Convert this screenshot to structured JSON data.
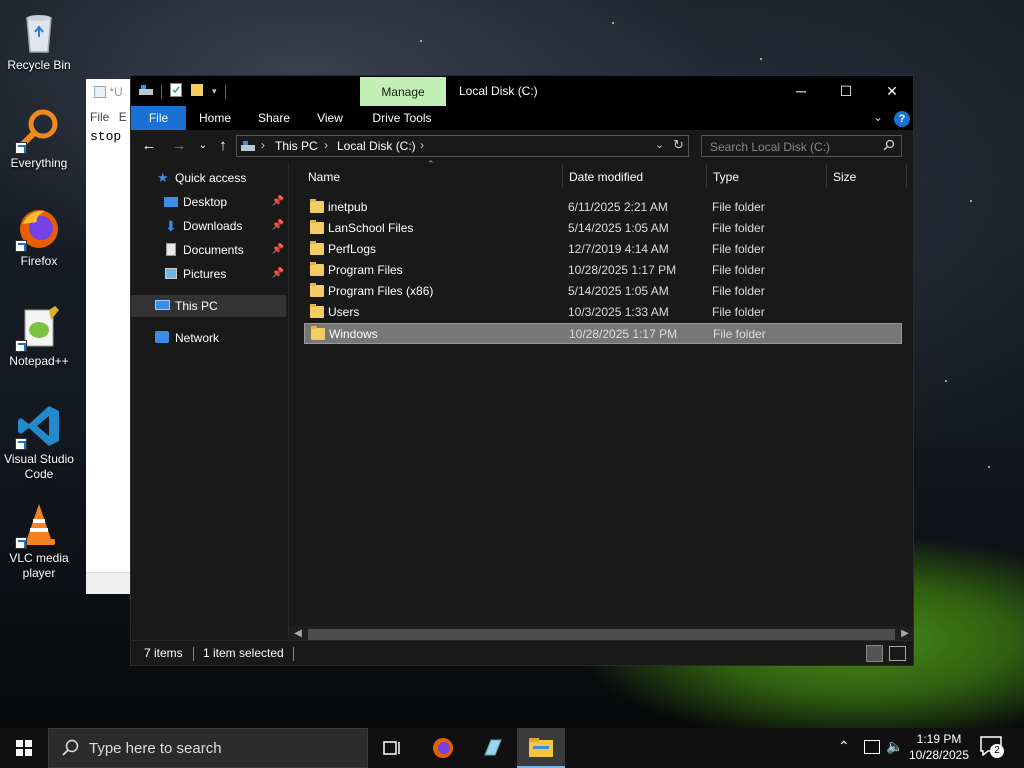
{
  "desktop": {
    "icons": [
      {
        "label": "Recycle Bin",
        "icon": "recycle-bin-icon"
      },
      {
        "label": "Everything",
        "icon": "everything-search-icon"
      },
      {
        "label": "Firefox",
        "icon": "firefox-icon"
      },
      {
        "label": "Notepad++",
        "icon": "notepad-plus-plus-icon"
      },
      {
        "label": "Visual Studio Code",
        "icon": "vscode-icon"
      },
      {
        "label": "VLC media player",
        "icon": "vlc-icon"
      }
    ]
  },
  "notepad": {
    "title_fragment": "*U",
    "menu_file": "File",
    "menu_edit_fragment": "E",
    "text": "stop"
  },
  "explorer": {
    "window_title": "Local Disk (C:)",
    "manage_tab": "Manage",
    "ribbon_tabs": [
      "File",
      "Home",
      "Share",
      "View",
      "Drive Tools"
    ],
    "address": {
      "crumbs": [
        "This PC",
        "Local Disk (C:)"
      ]
    },
    "search_placeholder": "Search Local Disk (C:)",
    "nav": {
      "quick_access": "Quick access",
      "pinned": [
        {
          "label": "Desktop",
          "icon": "desktop-icon"
        },
        {
          "label": "Downloads",
          "icon": "downloads-icon"
        },
        {
          "label": "Documents",
          "icon": "documents-icon"
        },
        {
          "label": "Pictures",
          "icon": "pictures-icon"
        }
      ],
      "this_pc": "This PC",
      "network": "Network"
    },
    "columns": [
      "Name",
      "Date modified",
      "Type",
      "Size"
    ],
    "files": [
      {
        "name": "inetpub",
        "date": "6/11/2025 2:21 AM",
        "type": "File folder"
      },
      {
        "name": "LanSchool Files",
        "date": "5/14/2025 1:05 AM",
        "type": "File folder"
      },
      {
        "name": "PerfLogs",
        "date": "12/7/2019 4:14 AM",
        "type": "File folder"
      },
      {
        "name": "Program Files",
        "date": "10/28/2025 1:17 PM",
        "type": "File folder"
      },
      {
        "name": "Program Files (x86)",
        "date": "5/14/2025 1:05 AM",
        "type": "File folder"
      },
      {
        "name": "Users",
        "date": "10/3/2025 1:33 AM",
        "type": "File folder"
      },
      {
        "name": "Windows",
        "date": "10/28/2025 1:17 PM",
        "type": "File folder"
      }
    ],
    "selected_file": "Windows",
    "status": {
      "items": "7 items",
      "selected": "1 item selected"
    }
  },
  "taskbar": {
    "search_placeholder": "Type here to search",
    "time": "1:19 PM",
    "date": "10/28/2025",
    "notification_count": "2"
  },
  "colors": {
    "accent": "#1a73d4",
    "manage_tab": "#c2f0b4",
    "folder": "#f4cd62"
  }
}
